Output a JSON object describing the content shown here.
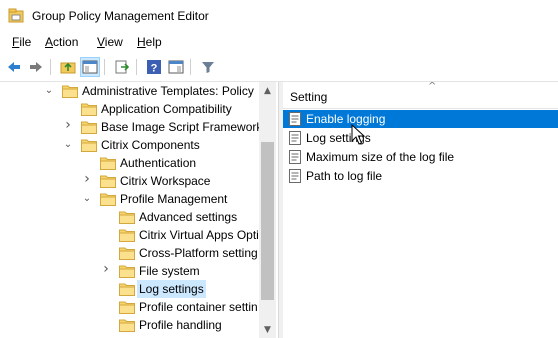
{
  "window": {
    "title": "Group Policy Management Editor"
  },
  "menu": [
    {
      "accel": "F",
      "rest": "ile"
    },
    {
      "accel": "A",
      "rest": "ction"
    },
    {
      "accel": "V",
      "rest": "iew"
    },
    {
      "accel": "H",
      "rest": "elp"
    }
  ],
  "toolbar": {
    "buttons": [
      "back-arrow-icon",
      "forward-arrow-icon",
      "up-folder-icon",
      "show-hide-tree-icon",
      "export-list-icon",
      "help-icon",
      "properties-pane-icon",
      "filter-icon"
    ]
  },
  "tree": {
    "items": [
      {
        "label": "Administrative Templates: Policy",
        "expander": "open"
      },
      {
        "label": "Application Compatibility",
        "expander": "none"
      },
      {
        "label": "Base Image Script Framework",
        "expander": "closed"
      },
      {
        "label": "Citrix Components",
        "expander": "open"
      },
      {
        "label": "Authentication",
        "expander": "none"
      },
      {
        "label": "Citrix Workspace",
        "expander": "closed"
      },
      {
        "label": "Profile Management",
        "expander": "open"
      },
      {
        "label": "Advanced settings",
        "expander": "none"
      },
      {
        "label": "Citrix Virtual Apps Opti",
        "expander": "none"
      },
      {
        "label": "Cross-Platform setting",
        "expander": "none"
      },
      {
        "label": "File system",
        "expander": "closed"
      },
      {
        "label": "Log settings",
        "expander": "none",
        "selected": true
      },
      {
        "label": "Profile container settin",
        "expander": "none"
      },
      {
        "label": "Profile handling",
        "expander": "none"
      }
    ]
  },
  "settings": {
    "column_header": "Setting",
    "items": [
      {
        "label": "Enable logging",
        "selected": true
      },
      {
        "label": "Log settings"
      },
      {
        "label": "Maximum size of the log file"
      },
      {
        "label": "Path to log file"
      }
    ]
  },
  "colors": {
    "selection_blue": "#0078d7",
    "tree_selection": "#cce8ff",
    "folder_yellow": "#f6d36b"
  }
}
